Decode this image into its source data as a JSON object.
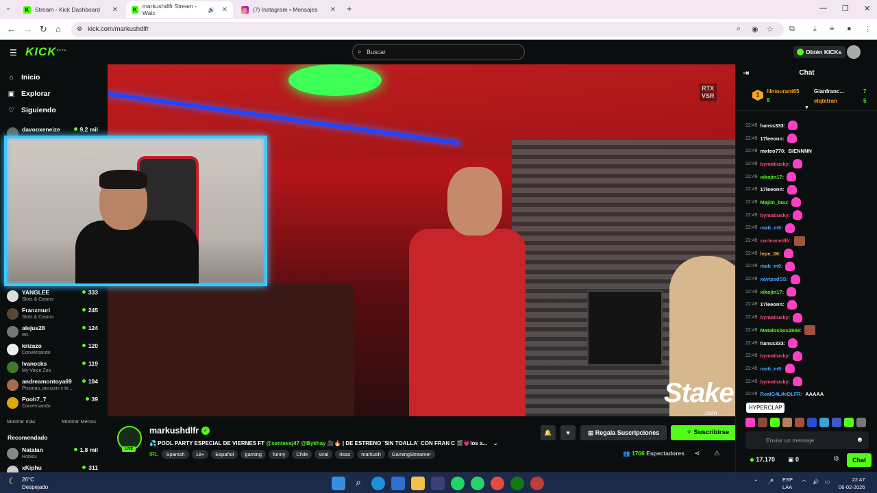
{
  "browser": {
    "tabs": [
      {
        "title": "Stream - Kick Dashboard"
      },
      {
        "title": "markushdlfr Stream - Watc"
      },
      {
        "title": "(7) Instagram • Mensajes"
      }
    ],
    "url": "kick.com/markushdlfr"
  },
  "header": {
    "logo": "KICK",
    "logo_beta": "BETA",
    "search_placeholder": "Buscar",
    "get_kicks": "Obtén KICKs"
  },
  "sidebar": {
    "nav": [
      {
        "label": "Inicio"
      },
      {
        "label": "Explorar"
      },
      {
        "label": "Siguiendo"
      }
    ],
    "following": [
      {
        "name": "davooxeneize",
        "viewers": "9,2 mil",
        "category": ""
      },
      {
        "name": "YANGLEE",
        "viewers": "333",
        "category": "Slots & Casino"
      },
      {
        "name": "Franzmuri",
        "viewers": "245",
        "category": "Slots & Casino"
      },
      {
        "name": "alejus28",
        "viewers": "124",
        "category": "IRL"
      },
      {
        "name": "krizazo",
        "viewers": "120",
        "category": "Conversando"
      },
      {
        "name": "Ivanocks",
        "viewers": "119",
        "category": "My Voice Zoo"
      },
      {
        "name": "andreamontoya69",
        "viewers": "104",
        "category": "Piscinas, jacuzzis y bi..."
      },
      {
        "name": "Pooh7_7",
        "viewers": "39",
        "category": "Conversando"
      }
    ],
    "show_more": "Mostrar más",
    "show_less": "Mostrar Menos",
    "recommended_title": "Recomendado",
    "recommended": [
      {
        "name": "Natalan",
        "viewers": "1,8 mil",
        "category": "Roblox"
      },
      {
        "name": "xKiphu",
        "viewers": "311",
        "category": ""
      }
    ]
  },
  "video": {
    "rtx_line1": "RTX",
    "rtx_line2": "VSR",
    "sponsor": "Stake",
    "sponsor_sub": ".com"
  },
  "stream": {
    "streamer": "markushdlfr",
    "live_badge": "LIVE",
    "title_prefix": "💦 POOL PARTY ESPECIAL DE VIERNES FT ",
    "title_mentions": "@xentessj47 @Bykhay",
    "title_suffix": " 🎥🔥 | DE ESTRENO ¨SIN TOALLA¨ CON FRAN C 🎬💗los a...",
    "category": "IRL",
    "tags": [
      "Spanish",
      "18+",
      "Español",
      "gaming",
      "funny",
      "Chile",
      "viral",
      "risas",
      "markush",
      "GamingStreamer"
    ],
    "gift_subs": "Regala Suscripciones",
    "subscribe": "Suscribirse",
    "viewers_count": "1766",
    "viewers_label": "Espectadores"
  },
  "chat": {
    "title": "Chat",
    "leaderboard": [
      {
        "rank": "1",
        "name": "lilmourant65",
        "count": "9"
      },
      {
        "name": "Gianfranc...",
        "count": "7"
      },
      {
        "name": "elqtetran",
        "count": "5"
      }
    ],
    "messages": [
      {
        "time": "22:49",
        "user": "hanss333:",
        "color": "#ffffff",
        "text": "",
        "emote": "pink"
      },
      {
        "time": "22:49",
        "user": "17leeonn:",
        "color": "#ffffff",
        "text": "",
        "emote": "pink"
      },
      {
        "time": "22:49",
        "user": "mxteo770:",
        "color": "#ffffff",
        "text": "BIENNNN",
        "emote": ""
      },
      {
        "time": "22:49",
        "user": "bymatiusky:",
        "color": "#ff4a7a",
        "text": "",
        "emote": "pink"
      },
      {
        "time": "22:49",
        "user": "xikojin17:",
        "color": "#53fc18",
        "text": "",
        "emote": "pink"
      },
      {
        "time": "22:49",
        "user": "17leeonn:",
        "color": "#ffffff",
        "text": "",
        "emote": "pink"
      },
      {
        "time": "22:49",
        "user": "Majiin_buu:",
        "color": "#53fc18",
        "text": "",
        "emote": "pink"
      },
      {
        "time": "22:49",
        "user": "bymatiusky:",
        "color": "#ff4a7a",
        "text": "",
        "emote": "pink"
      },
      {
        "time": "22:49",
        "user": "mati_m9:",
        "color": "#4aa8ff",
        "text": "",
        "emote": "pink"
      },
      {
        "time": "22:49",
        "user": "corleonedlfr:",
        "color": "#ff4a7a",
        "text": "",
        "emote": "square"
      },
      {
        "time": "22:49",
        "user": "lepe_06:",
        "color": "#ffb347",
        "text": "",
        "emote": "pink"
      },
      {
        "time": "22:49",
        "user": "mati_m9:",
        "color": "#4aa8ff",
        "text": "",
        "emote": "pink"
      },
      {
        "time": "22:49",
        "user": "xavipsdSS:",
        "color": "#4aa8ff",
        "text": "",
        "emote": "pink"
      },
      {
        "time": "22:49",
        "user": "xikojin17:",
        "color": "#53fc18",
        "text": "",
        "emote": "pink"
      },
      {
        "time": "22:49",
        "user": "17leeonn:",
        "color": "#ffffff",
        "text": "",
        "emote": "pink"
      },
      {
        "time": "22:49",
        "user": "bymatiusky:",
        "color": "#ff4a7a",
        "text": "",
        "emote": "pink"
      },
      {
        "time": "22:49",
        "user": "Matalosbos2848:",
        "color": "#53fc18",
        "text": "",
        "emote": "square"
      },
      {
        "time": "22:49",
        "user": "hanss333:",
        "color": "#ffffff",
        "text": "",
        "emote": "pink"
      },
      {
        "time": "22:49",
        "user": "bymatiusky:",
        "color": "#ff4a7a",
        "text": "",
        "emote": "pink"
      },
      {
        "time": "22:49",
        "user": "mati_m9:",
        "color": "#4aa8ff",
        "text": "",
        "emote": "pink"
      },
      {
        "time": "22:49",
        "user": "bymatiusky:",
        "color": "#ff4a7a",
        "text": "",
        "emote": "pink"
      },
      {
        "time": "22:49",
        "user": "RealG4LifeDLFR:",
        "color": "#4aa8ff",
        "text": "AAAAA",
        "emote": ""
      }
    ],
    "tooltip": "HYPERCLAP",
    "input_placeholder": "Enviar un mensaje",
    "kicks_balance": "17.170",
    "chest_count": "0",
    "chat_button": "Chat"
  },
  "taskbar": {
    "temp": "26°C",
    "weather": "Despejado",
    "lang1": "ESP",
    "lang2": "LAA",
    "time": "22:47",
    "date": "06-02-2026"
  },
  "colors": {
    "accent": "#53fc18",
    "background": "#0b0e0f",
    "cam_border": "#3ec6ff"
  }
}
